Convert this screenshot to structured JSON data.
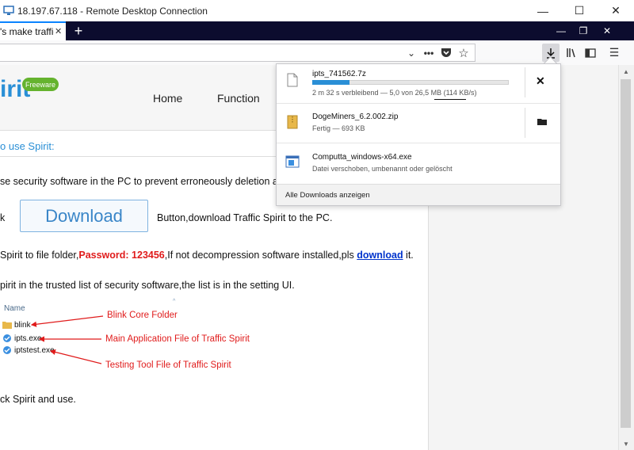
{
  "window": {
    "title": "18.197.67.118 - Remote Desktop Connection",
    "minimize": "—",
    "maximize": "☐",
    "close": "✕"
  },
  "browser": {
    "tab_title": "'s make traffic t",
    "new_tab": "+",
    "tab_minimize": "—",
    "tab_restore": "❐",
    "tab_close": "✕",
    "nav_icons": [
      "chevron-down-icon",
      "more-icon",
      "pocket-icon",
      "star-icon",
      "download-icon",
      "library-icon",
      "sidebar-icon",
      "menu-icon"
    ]
  },
  "site": {
    "logo": "irit",
    "badge": "Freeware",
    "menu": [
      "Home",
      "Function"
    ]
  },
  "content": {
    "heading": "o use Spirit:",
    "line1": "se security software in the PC to prevent erroneously deletion afte",
    "line2_pre": "k",
    "download_button": "Download",
    "line2_post": "Button,download Traffic Spirit to the PC.",
    "line3_pre": "Spirit to file folder,",
    "line3_password": "Password: 123456",
    "line3_mid": ",If not decompression software installed,pls ",
    "line3_link": "download",
    "line3_post": " it.",
    "line4": "pirit in the trusted list of security software,the list is in the setting UI.",
    "line5": "ck Spirit and use."
  },
  "explorer": {
    "column": "Name",
    "files": [
      "blink",
      "ipts.exe",
      "iptstest.exe"
    ],
    "annotations": [
      "Blink Core Folder",
      "Main Application File of Traffic Spirit",
      "Testing Tool File of Traffic Spirit"
    ]
  },
  "downloads": {
    "items": [
      {
        "name": "ipts_741562.7z",
        "status": "2 m 32 s verbleibend — 5,0 von 26,5 MB (114 KB/s)",
        "progress": 0.19
      },
      {
        "name": "DogeMiners_6.2.002.zip",
        "status": "Fertig — 693 KB"
      },
      {
        "name": "Computta_windows-x64.exe",
        "status": "Datei verschoben, umbenannt oder gelöscht"
      }
    ],
    "footer": "Alle Downloads anzeigen"
  },
  "colors": {
    "accent": "#2a8fd6",
    "tabbar": "#0c0c2e",
    "annotation": "#e01b1b",
    "badge": "#65b32e"
  }
}
